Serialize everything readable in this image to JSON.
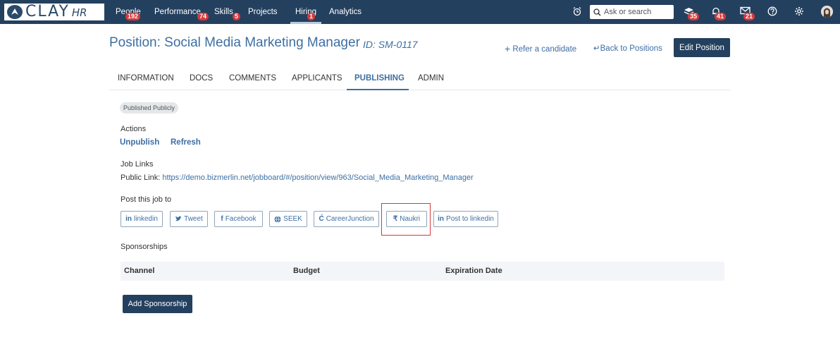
{
  "brand": {
    "name": "CLAY",
    "suffix": "HR"
  },
  "nav": {
    "items": [
      {
        "label": "People",
        "badge": "192"
      },
      {
        "label": "Performance",
        "badge": "74"
      },
      {
        "label": "Skills",
        "badge": "5"
      },
      {
        "label": "Projects",
        "badge": ""
      },
      {
        "label": "Hiring",
        "badge": "1"
      },
      {
        "label": "Analytics",
        "badge": ""
      }
    ],
    "active": "Hiring",
    "search_placeholder": "Ask or search",
    "badges": {
      "learning": "35",
      "notifications": "41",
      "messages": "21"
    },
    "badge_color": "#d43a3a",
    "navbar_color": "#24405f"
  },
  "header": {
    "title": "Position: Social Media Marketing Manager",
    "id": "ID: SM-0117",
    "refer": "Refer a candidate",
    "back": "Back to Positions",
    "edit": "Edit Position"
  },
  "tabs": [
    "INFORMATION",
    "DOCS",
    "COMMENTS",
    "APPLICANTS",
    "PUBLISHING",
    "ADMIN"
  ],
  "active_tab": "PUBLISHING",
  "status": "Published Publicly",
  "actions": {
    "label": "Actions",
    "unpublish": "Unpublish",
    "refresh": "Refresh"
  },
  "job_links": {
    "label": "Job Links",
    "public_label": "Public Link:",
    "url": "https://demo.bizmerlin.net/jobboard/#/position/view/963/Social_Media_Marketing_Manager"
  },
  "post": {
    "label": "Post this job to",
    "buttons": [
      {
        "label": "linkedin",
        "icon": "linkedin-icon"
      },
      {
        "label": "Tweet",
        "icon": "twitter-icon"
      },
      {
        "label": "Facebook",
        "icon": "facebook-icon"
      },
      {
        "label": "SEEK",
        "icon": "globe-icon"
      },
      {
        "label": "CareerJunction",
        "icon": "careerjunction-icon"
      },
      {
        "label": "Naukri",
        "icon": "rupee-icon"
      },
      {
        "label": "Post to linkedin",
        "icon": "linkedin-icon"
      }
    ],
    "highlight_color": "#d43a3a"
  },
  "sponsorships": {
    "label": "Sponsorships",
    "columns": [
      "Channel",
      "Budget",
      "Expiration Date"
    ],
    "add": "Add Sponsorship"
  },
  "accent_color": "#3d6fa3"
}
